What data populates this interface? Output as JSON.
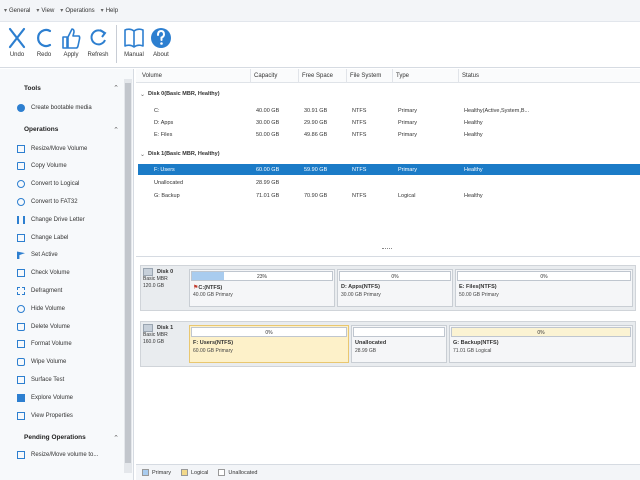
{
  "menu": [
    {
      "label": "General"
    },
    {
      "label": "View"
    },
    {
      "label": "Operations"
    },
    {
      "label": "Help"
    }
  ],
  "toolbar": {
    "undo": "Undo",
    "redo": "Redo",
    "apply": "Apply",
    "refresh": "Refresh",
    "manual": "Manual",
    "about": "About"
  },
  "sidebar": {
    "tools_title": "Tools",
    "tools": [
      {
        "label": "Create bootable media",
        "icon": "bootable-media-icon"
      }
    ],
    "operations_title": "Operations",
    "operations": [
      {
        "label": "Resize/Move Volume"
      },
      {
        "label": "Copy Volume"
      },
      {
        "label": "Convert to Logical"
      },
      {
        "label": "Convert to FAT32"
      },
      {
        "label": "Change Drive Letter"
      },
      {
        "label": "Change Label"
      },
      {
        "label": "Set Active"
      },
      {
        "label": "Check Volume"
      },
      {
        "label": "Defragment"
      },
      {
        "label": "Hide Volume"
      },
      {
        "label": "Delete Volume"
      },
      {
        "label": "Format Volume"
      },
      {
        "label": "Wipe Volume"
      },
      {
        "label": "Surface Test"
      },
      {
        "label": "Explore Volume"
      },
      {
        "label": "View Properties"
      }
    ],
    "pending_title": "Pending Operations",
    "pending": [
      {
        "label": "Resize/Move volume to..."
      }
    ]
  },
  "volume_list": {
    "columns": [
      "Volume",
      "Capacity",
      "Free Space",
      "File System",
      "Type",
      "Status"
    ],
    "disks": [
      {
        "title": "Disk 0(Basic MBR, Healthy)",
        "rows": [
          {
            "volume": "C:",
            "capacity": "40.00 GB",
            "free": "30.91 GB",
            "fs": "NTFS",
            "type": "Primary",
            "status": "Healthy(Active,System,B..."
          },
          {
            "volume": "D: Apps",
            "capacity": "30.00 GB",
            "free": "29.90 GB",
            "fs": "NTFS",
            "type": "Primary",
            "status": "Healthy"
          },
          {
            "volume": "E: Files",
            "capacity": "50.00 GB",
            "free": "49.86 GB",
            "fs": "NTFS",
            "type": "Primary",
            "status": "Healthy"
          }
        ]
      },
      {
        "title": "Disk 1(Basic MBR, Healthy)",
        "rows": [
          {
            "volume": "F: Users",
            "capacity": "60.00 GB",
            "free": "59.90 GB",
            "fs": "NTFS",
            "type": "Primary",
            "status": "Healthy",
            "selected": true
          },
          {
            "volume": "Unallocated",
            "capacity": "28.99 GB",
            "free": "",
            "fs": "",
            "type": "",
            "status": ""
          },
          {
            "volume": "G: Backup",
            "capacity": "71.01 GB",
            "free": "70.90 GB",
            "fs": "NTFS",
            "type": "Logical",
            "status": "Healthy"
          }
        ]
      }
    ]
  },
  "disk_map": [
    {
      "name": "Disk 0",
      "kind": "Basic MBR",
      "size": "120.0 GB",
      "partitions": [
        {
          "label": "C:(NTFS)",
          "desc": "40.00 GB Primary",
          "percent": "23%",
          "used": 0.23,
          "flag": true
        },
        {
          "label": "D: Apps(NTFS)",
          "desc": "30.00 GB Primary",
          "percent": "0%",
          "used": 0.0
        },
        {
          "label": "E: Files(NTFS)",
          "desc": "50.00 GB Primary",
          "percent": "0%",
          "used": 0.0
        }
      ]
    },
    {
      "name": "Disk 1",
      "kind": "Basic MBR",
      "size": "160.0 GB",
      "partitions": [
        {
          "label": "F: Users(NTFS)",
          "desc": "60.00 GB Primary",
          "percent": "0%",
          "used": 0.0,
          "selected": true
        },
        {
          "label": "Unallocated",
          "desc": "28.99 GB",
          "percent": "",
          "used": 0.0,
          "unallocated": true
        },
        {
          "label": "G: Backup(NTFS)",
          "desc": "71.01 GB Logical",
          "percent": "0%",
          "used": 0.0,
          "logical": true
        }
      ]
    }
  ],
  "legend": [
    {
      "label": "Primary",
      "color": "#a9ccef"
    },
    {
      "label": "Logical",
      "color": "#f3d98a"
    },
    {
      "label": "Unallocated",
      "color": "#ffffff"
    }
  ],
  "colors": {
    "accent": "#1b7bc7",
    "icon_blue": "#2d7fd0",
    "selected_partition": "#fdf1c9"
  }
}
